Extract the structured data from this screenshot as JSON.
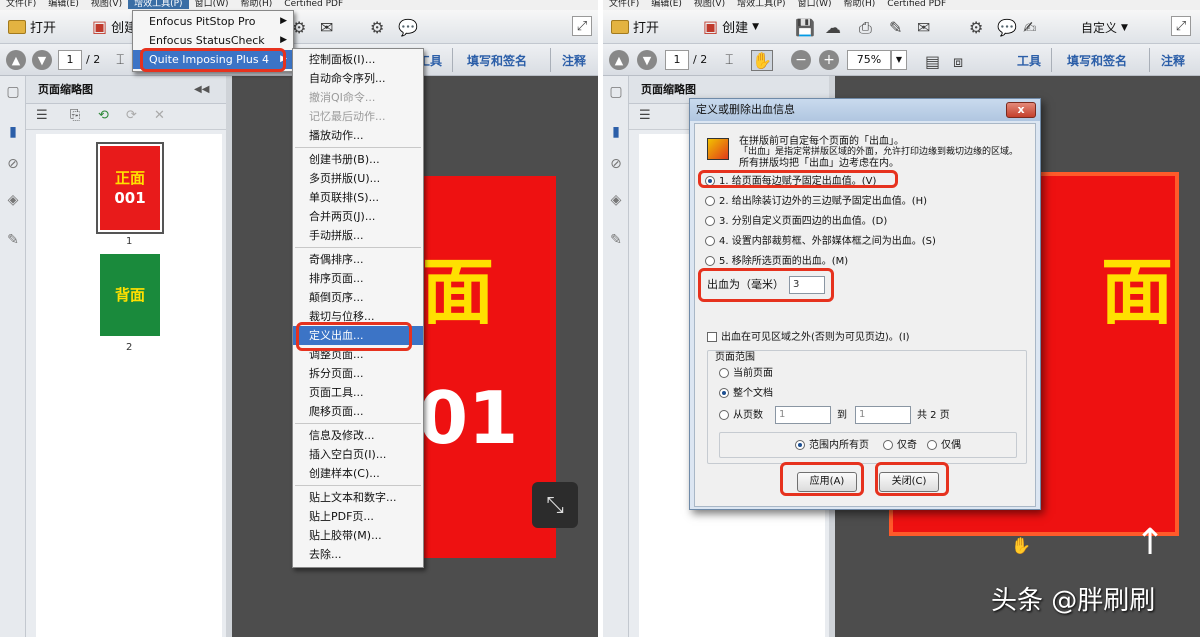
{
  "left": {
    "menubar": [
      "文件(F)",
      "编辑(E)",
      "视图(V)",
      "增效工具(P)",
      "窗口(W)",
      "帮助(H)",
      "Certified PDF"
    ],
    "toolbar": {
      "open": "打开",
      "create": "创建",
      "page_current": "1",
      "page_total": "/ 2",
      "tools": "工具",
      "fill_sign": "填写和签名",
      "comment": "注释"
    },
    "panel_title": "页面缩略图",
    "thumbs": [
      {
        "text1": "正面",
        "text2": "001",
        "label": "1"
      },
      {
        "text1": "背面",
        "text2": "",
        "label": "2"
      }
    ],
    "page_text_1": "面",
    "page_text_2": "01",
    "plugins_menu": [
      "Enfocus PitStop Pro",
      "Enfocus StatusCheck",
      "Quite Imposing Plus 4"
    ],
    "qi_menu": [
      {
        "label": "控制面板(I)...",
        "disabled": false
      },
      {
        "label": "自动命令序列...",
        "disabled": false
      },
      {
        "label": "撤消QI命令...",
        "disabled": true
      },
      {
        "label": "记忆最后动作...",
        "disabled": true
      },
      {
        "label": "播放动作...",
        "disabled": false
      },
      {
        "sep": true
      },
      {
        "label": "创建书册(B)...",
        "disabled": false
      },
      {
        "label": "多页拼版(U)...",
        "disabled": false
      },
      {
        "label": "单页联排(S)...",
        "disabled": false
      },
      {
        "label": "合并两页(J)...",
        "disabled": false
      },
      {
        "label": "手动拼版...",
        "disabled": false
      },
      {
        "sep": true
      },
      {
        "label": "奇偶排序...",
        "disabled": false
      },
      {
        "label": "排序页面...",
        "disabled": false
      },
      {
        "label": "颠倒页序...",
        "disabled": false
      },
      {
        "label": "裁切与位移...",
        "disabled": false
      },
      {
        "label": "定义出血...",
        "disabled": false,
        "selected": true
      },
      {
        "label": "调整页面...",
        "disabled": false
      },
      {
        "label": "拆分页面...",
        "disabled": false
      },
      {
        "label": "页面工具...",
        "disabled": false
      },
      {
        "label": "爬移页面...",
        "disabled": false
      },
      {
        "sep": true
      },
      {
        "label": "信息及修改...",
        "disabled": false
      },
      {
        "label": "插入空白页(I)...",
        "disabled": false
      },
      {
        "label": "创建样本(C)...",
        "disabled": false
      },
      {
        "sep": true
      },
      {
        "label": "贴上文本和数字...",
        "disabled": false
      },
      {
        "label": "贴上PDF页...",
        "disabled": false
      },
      {
        "label": "贴上胶带(M)...",
        "disabled": false
      },
      {
        "label": "去除...",
        "disabled": false
      }
    ]
  },
  "right": {
    "menubar": [
      "文件(F)",
      "编辑(E)",
      "视图(V)",
      "增效工具(P)",
      "窗口(W)",
      "帮助(H)",
      "Certified PDF"
    ],
    "toolbar": {
      "open": "打开",
      "create": "创建",
      "customize": "自定义",
      "page_current": "1",
      "page_total": "/ 2",
      "zoom": "75%",
      "tools": "工具",
      "fill_sign": "填写和签名",
      "comment": "注释"
    },
    "panel_title": "页面缩略图",
    "page_text": "面",
    "dialog": {
      "title": "定义或删除出血信息",
      "close": "x",
      "intro": [
        "在拼版前可自定每个页面的「出血」。",
        "「出血」是指定常拼版区域的外面，允许打印边缘到裁切边缘的区域。",
        "所有拼版均把「出血」边考虑在内。"
      ],
      "options": [
        {
          "label": "1. 给页面每边赋予固定出血值。(V)",
          "on": true
        },
        {
          "label": "2. 给出除装订边外的三边赋予固定出血值。(H)",
          "on": false
        },
        {
          "label": "3. 分别自定义页面四边的出血值。(D)",
          "on": false
        },
        {
          "label": "4. 设置内部裁剪框、外部媒体框之间为出血。(S)",
          "on": false
        },
        {
          "label": "5. 移除所选页面的出血。(M)",
          "on": false
        }
      ],
      "bleed_label": "出血为（毫米）",
      "bleed_value": "3",
      "outside_check": "出血在可见区域之外(否则为可见页边)。(I)",
      "range_title": "页面范围",
      "range_current": "当前页面",
      "range_all": "整个文档",
      "range_from": "从页数",
      "from_value": "1",
      "to_label": "到",
      "to_value": "1",
      "total": "共 2 页",
      "subset_all": "范围内所有页",
      "subset_odd": "仅奇",
      "subset_even": "仅偶",
      "apply": "应用(A)",
      "close_btn": "关闭(C)"
    },
    "watermark": "头条 @胖刷刷"
  },
  "colors": {
    "accent": "#3c74c6",
    "highlight": "#e6321e",
    "page_red": "#ee1111",
    "page_green": "#1a8a3c",
    "text_yellow": "#ffe000"
  }
}
